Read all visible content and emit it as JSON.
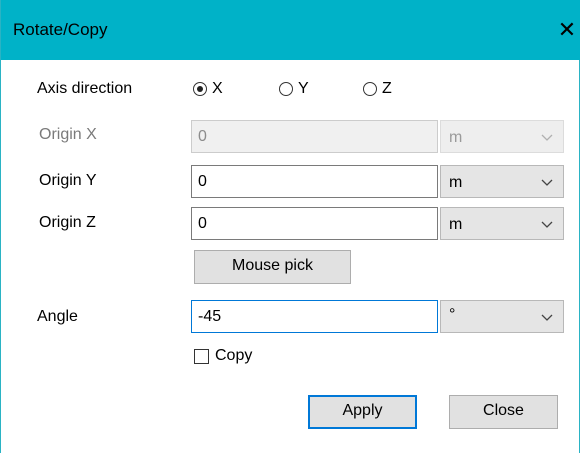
{
  "window": {
    "title": "Rotate/Copy",
    "close_glyph": "✕"
  },
  "axis": {
    "label": "Axis direction",
    "options": [
      {
        "label": "X",
        "checked": true
      },
      {
        "label": "Y",
        "checked": false
      },
      {
        "label": "Z",
        "checked": false
      }
    ]
  },
  "origin_x": {
    "label": "Origin X",
    "value": "0",
    "unit": "m",
    "enabled": false
  },
  "origin_y": {
    "label": "Origin Y",
    "value": "0",
    "unit": "m",
    "enabled": true
  },
  "origin_z": {
    "label": "Origin Z",
    "value": "0",
    "unit": "m",
    "enabled": true
  },
  "mouse_pick_label": "Mouse pick",
  "angle": {
    "label": "Angle",
    "value": "-45",
    "unit": "°"
  },
  "copy": {
    "label": "Copy",
    "checked": false
  },
  "buttons": {
    "apply": "Apply",
    "close": "Close"
  },
  "colors": {
    "titlebar": "#00b2c8",
    "focus_border": "#0078d7"
  }
}
